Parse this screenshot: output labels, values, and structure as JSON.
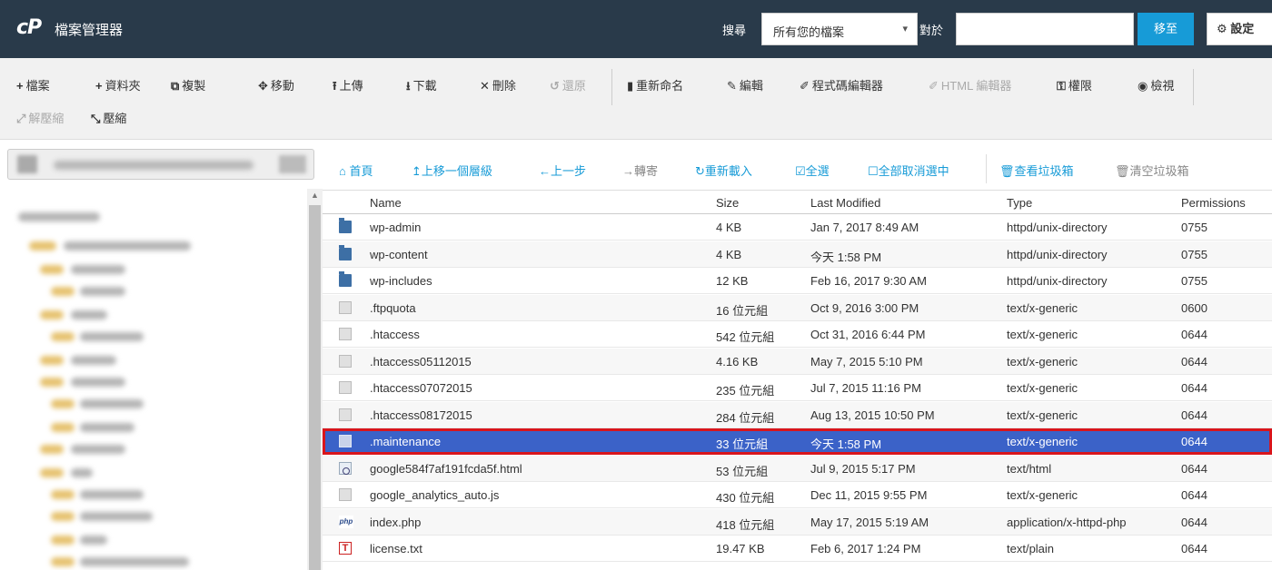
{
  "header": {
    "logo": "cP",
    "title": "檔案管理器",
    "search_label": "搜尋",
    "search_scope": "所有您的檔案",
    "for_label": "對於",
    "search_placeholder": "",
    "go_label": "移至",
    "settings_label": "設定"
  },
  "toolbar": {
    "file": "檔案",
    "folder": "資料夾",
    "copy": "複製",
    "move": "移動",
    "upload": "上傳",
    "download": "下載",
    "delete": "刪除",
    "restore": "還原",
    "rename": "重新命名",
    "edit": "編輯",
    "code_editor": "程式碼編輯器",
    "html_editor": "HTML 編輯器",
    "permissions": "權限",
    "view": "檢視",
    "extract": "解壓縮",
    "compress": "壓縮"
  },
  "nav": {
    "home": "首頁",
    "up_level": "上移一個層級",
    "back": "上一步",
    "forward": "轉寄",
    "reload": "重新載入",
    "select_all": "全選",
    "unselect_all": "全部取消選中",
    "view_trash": "查看垃圾箱",
    "empty_trash": "清空垃圾箱"
  },
  "table": {
    "columns": [
      "Name",
      "Size",
      "Last Modified",
      "Type",
      "Permissions"
    ],
    "rows": [
      {
        "icon": "folder",
        "name": "wp-admin",
        "size": "4 KB",
        "modified": "Jan 7, 2017 8:49 AM",
        "type": "httpd/unix-directory",
        "perms": "0755"
      },
      {
        "icon": "folder",
        "name": "wp-content",
        "size": "4 KB",
        "modified": "今天 1:58 PM",
        "type": "httpd/unix-directory",
        "perms": "0755"
      },
      {
        "icon": "folder",
        "name": "wp-includes",
        "size": "12 KB",
        "modified": "Feb 16, 2017 9:30 AM",
        "type": "httpd/unix-directory",
        "perms": "0755"
      },
      {
        "icon": "file",
        "name": ".ftpquota",
        "size": "16 位元組",
        "modified": "Oct 9, 2016 3:00 PM",
        "type": "text/x-generic",
        "perms": "0600"
      },
      {
        "icon": "file",
        "name": ".htaccess",
        "size": "542 位元組",
        "modified": "Oct 31, 2016 6:44 PM",
        "type": "text/x-generic",
        "perms": "0644"
      },
      {
        "icon": "file",
        "name": ".htaccess05112015",
        "size": "4.16 KB",
        "modified": "May 7, 2015 5:10 PM",
        "type": "text/x-generic",
        "perms": "0644"
      },
      {
        "icon": "file",
        "name": ".htaccess07072015",
        "size": "235 位元組",
        "modified": "Jul 7, 2015 11:16 PM",
        "type": "text/x-generic",
        "perms": "0644"
      },
      {
        "icon": "file",
        "name": ".htaccess08172015",
        "size": "284 位元組",
        "modified": "Aug 13, 2015 10:50 PM",
        "type": "text/x-generic",
        "perms": "0644"
      },
      {
        "icon": "file",
        "name": ".maintenance",
        "size": "33 位元組",
        "modified": "今天 1:58 PM",
        "type": "text/x-generic",
        "perms": "0644"
      },
      {
        "icon": "html",
        "name": "google584f7af191fcda5f.html",
        "size": "53 位元組",
        "modified": "Jul 9, 2015 5:17 PM",
        "type": "text/html",
        "perms": "0644"
      },
      {
        "icon": "file",
        "name": "google_analytics_auto.js",
        "size": "430 位元組",
        "modified": "Dec 11, 2015 9:55 PM",
        "type": "text/x-generic",
        "perms": "0644"
      },
      {
        "icon": "php",
        "name": "index.php",
        "size": "418 位元組",
        "modified": "May 17, 2015 5:19 AM",
        "type": "application/x-httpd-php",
        "perms": "0644"
      },
      {
        "icon": "txt",
        "name": "license.txt",
        "size": "19.47 KB",
        "modified": "Feb 6, 2017 1:24 PM",
        "type": "text/plain",
        "perms": "0644"
      }
    ],
    "selected_index": 8
  },
  "colors": {
    "topbar": "#293a4a",
    "accent": "#179bd7",
    "selected_row": "#3b62c8",
    "highlight_border": "#d9151c"
  }
}
